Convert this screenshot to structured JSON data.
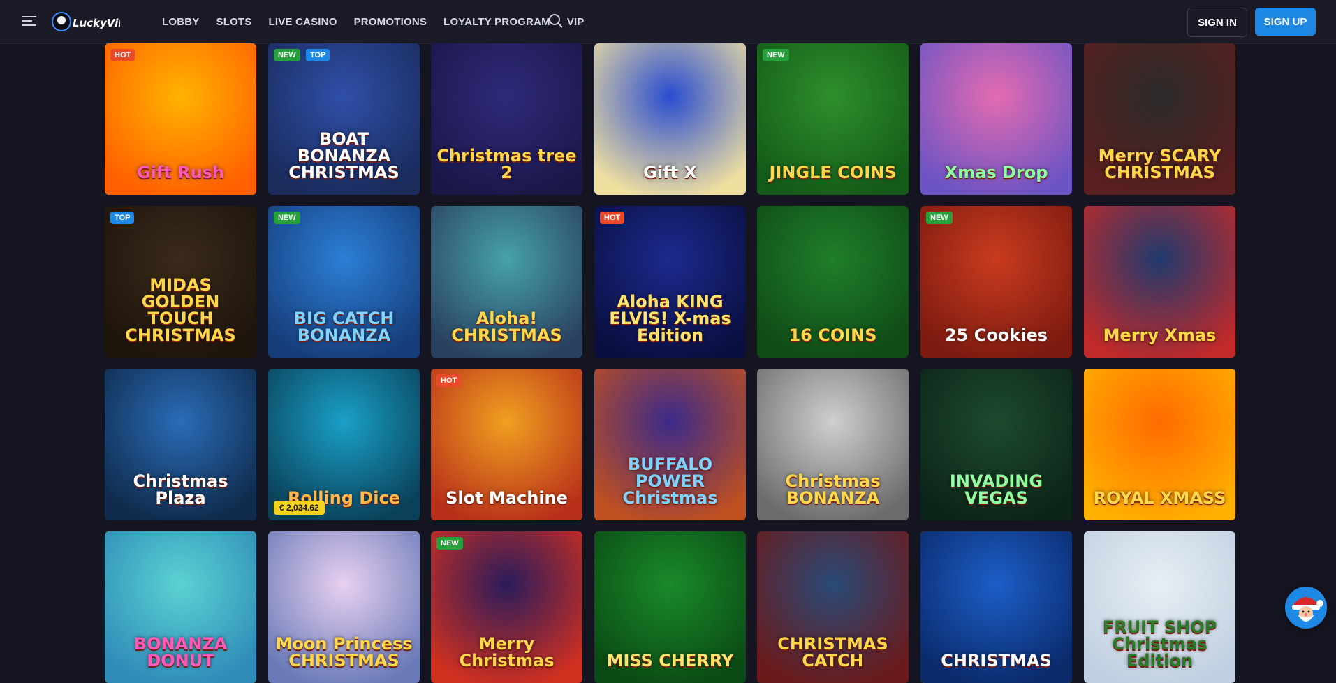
{
  "header": {
    "menu_icon": "hamburger-menu-icon",
    "logo_text": "LuckyVibe",
    "nav": [
      "LOBBY",
      "SLOTS",
      "LIVE CASINO",
      "PROMOTIONS",
      "LOYALTY PROGRAM",
      "VIP"
    ],
    "search_icon": "search-icon",
    "sign_in": "SIGN IN",
    "sign_up": "SIGN UP"
  },
  "colors": {
    "page_bg": "#141520",
    "header_bg": "#1a1b27",
    "accent": "#1e88e5",
    "hot": "#ea4a2a",
    "new": "#27a13b",
    "top": "#1e88e5",
    "jackpot": "#f4d11d"
  },
  "games": [
    {
      "title": "Gift Rush",
      "badges": [
        "HOT"
      ],
      "selected": true
    },
    {
      "title": "BOAT BONANZA CHRISTMAS",
      "badges": [
        "NEW",
        "TOP"
      ]
    },
    {
      "title": "Christmas tree 2",
      "badges": []
    },
    {
      "title": "Gift X",
      "badges": []
    },
    {
      "title": "JINGLE COINS",
      "badges": [
        "NEW"
      ]
    },
    {
      "title": "Xmas Drop",
      "badges": []
    },
    {
      "title": "Merry SCARY CHRISTMAS",
      "badges": []
    },
    {
      "title": "MIDAS GOLDEN TOUCH CHRISTMAS",
      "badges": [
        "TOP"
      ]
    },
    {
      "title": "BIG CATCH BONANZA",
      "badges": [
        "NEW"
      ]
    },
    {
      "title": "Aloha! CHRISTMAS",
      "badges": []
    },
    {
      "title": "Aloha KING ELVIS! X-mas Edition",
      "badges": [
        "HOT"
      ]
    },
    {
      "title": "16 COINS",
      "badges": []
    },
    {
      "title": "25 Cookies",
      "badges": [
        "NEW"
      ]
    },
    {
      "title": "Merry Xmas",
      "badges": []
    },
    {
      "title": "Christmas Plaza",
      "badges": []
    },
    {
      "title": "Rolling Dice",
      "badges": [],
      "jackpot": "€ 2,034.62"
    },
    {
      "title": "Slot Machine",
      "badges": [
        "HOT"
      ]
    },
    {
      "title": "BUFFALO POWER Christmas",
      "badges": []
    },
    {
      "title": "Christmas BONANZA",
      "badges": []
    },
    {
      "title": "INVADING VEGAS",
      "badges": []
    },
    {
      "title": "ROYAL XMASS",
      "badges": []
    },
    {
      "title": "BONANZA DONUT",
      "badges": [],
      "selected": true
    },
    {
      "title": "Moon Princess CHRISTMAS",
      "badges": []
    },
    {
      "title": "Merry Christmas",
      "badges": [
        "NEW"
      ]
    },
    {
      "title": "MISS CHERRY",
      "badges": []
    },
    {
      "title": "CHRISTMAS CATCH",
      "badges": []
    },
    {
      "title": "CHRISTMAS",
      "badges": [],
      "selected": true
    },
    {
      "title": "FRUIT SHOP Christmas Edition",
      "badges": []
    }
  ],
  "floating": {
    "icon": "santa-icon"
  }
}
